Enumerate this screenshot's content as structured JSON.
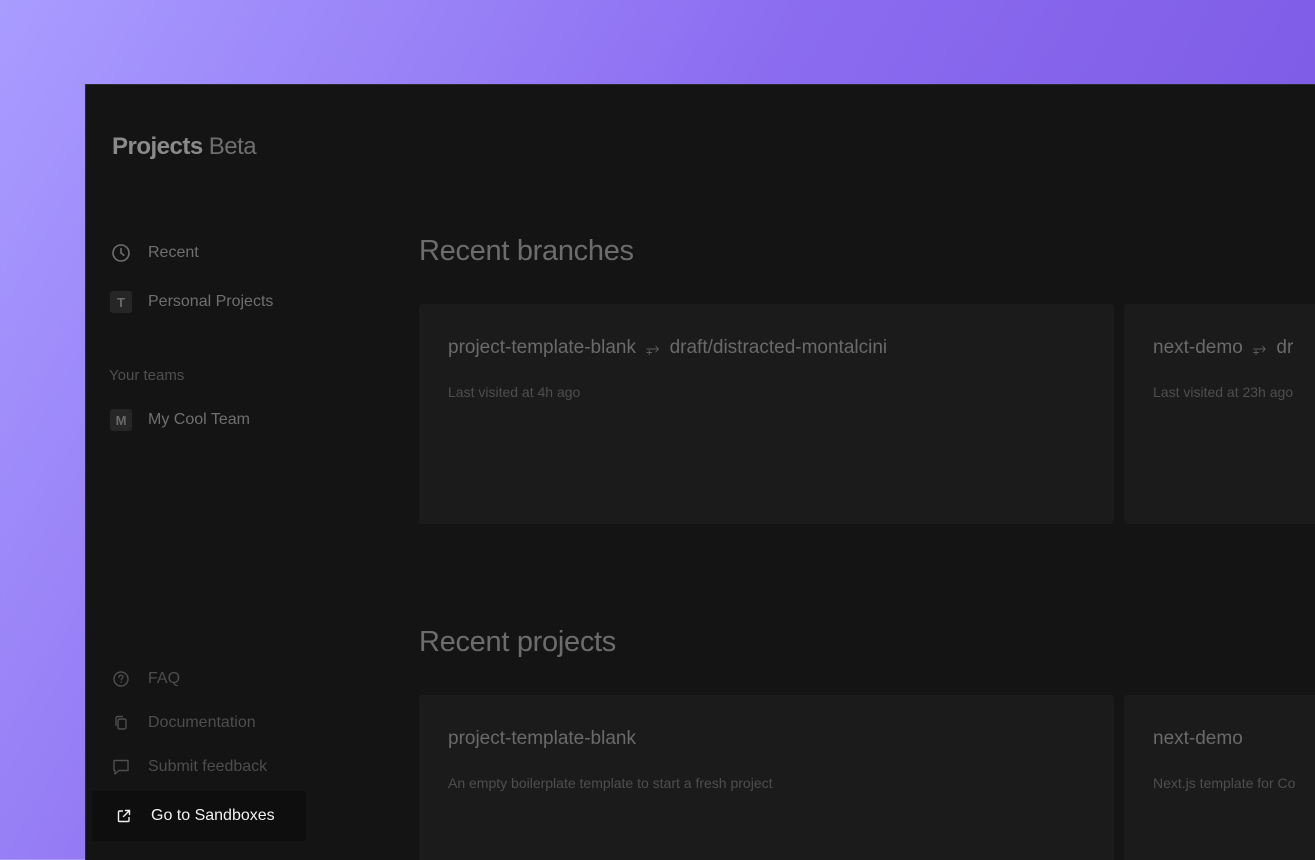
{
  "brand": {
    "name": "Projects",
    "tag": "Beta"
  },
  "sidebar": {
    "items": [
      {
        "label": "Recent",
        "icon": "clock-icon"
      },
      {
        "label": "Personal Projects",
        "icon_letter": "T"
      }
    ],
    "teams_label": "Your teams",
    "teams": [
      {
        "label": "My Cool Team",
        "icon_letter": "M"
      }
    ],
    "bottom": [
      {
        "label": "FAQ",
        "icon": "help-circle-icon"
      },
      {
        "label": "Documentation",
        "icon": "documents-icon"
      },
      {
        "label": "Submit feedback",
        "icon": "chat-icon"
      }
    ],
    "sandbox_button": {
      "label": "Go to Sandboxes",
      "icon": "external-link-icon"
    }
  },
  "main": {
    "branches_heading": "Recent branches",
    "branches": [
      {
        "project": "project-template-blank",
        "branch": "draft/distracted-montalcini",
        "visited": "Last visited at 4h ago"
      },
      {
        "project": "next-demo",
        "branch": "dr",
        "visited": "Last visited at 23h ago"
      }
    ],
    "projects_heading": "Recent projects",
    "projects": [
      {
        "name": "project-template-blank",
        "description": "An empty boilerplate template to start a fresh project"
      },
      {
        "name": "next-demo",
        "description": "Next.js template for Co"
      }
    ],
    "branch_separator": "⥅"
  },
  "colors": {
    "background_gradient_start": "#a99cff",
    "background_gradient_end": "#7650de",
    "app_bg": "#141414",
    "card_bg": "#1b1b1b",
    "button_bg": "#0e0e0e"
  }
}
